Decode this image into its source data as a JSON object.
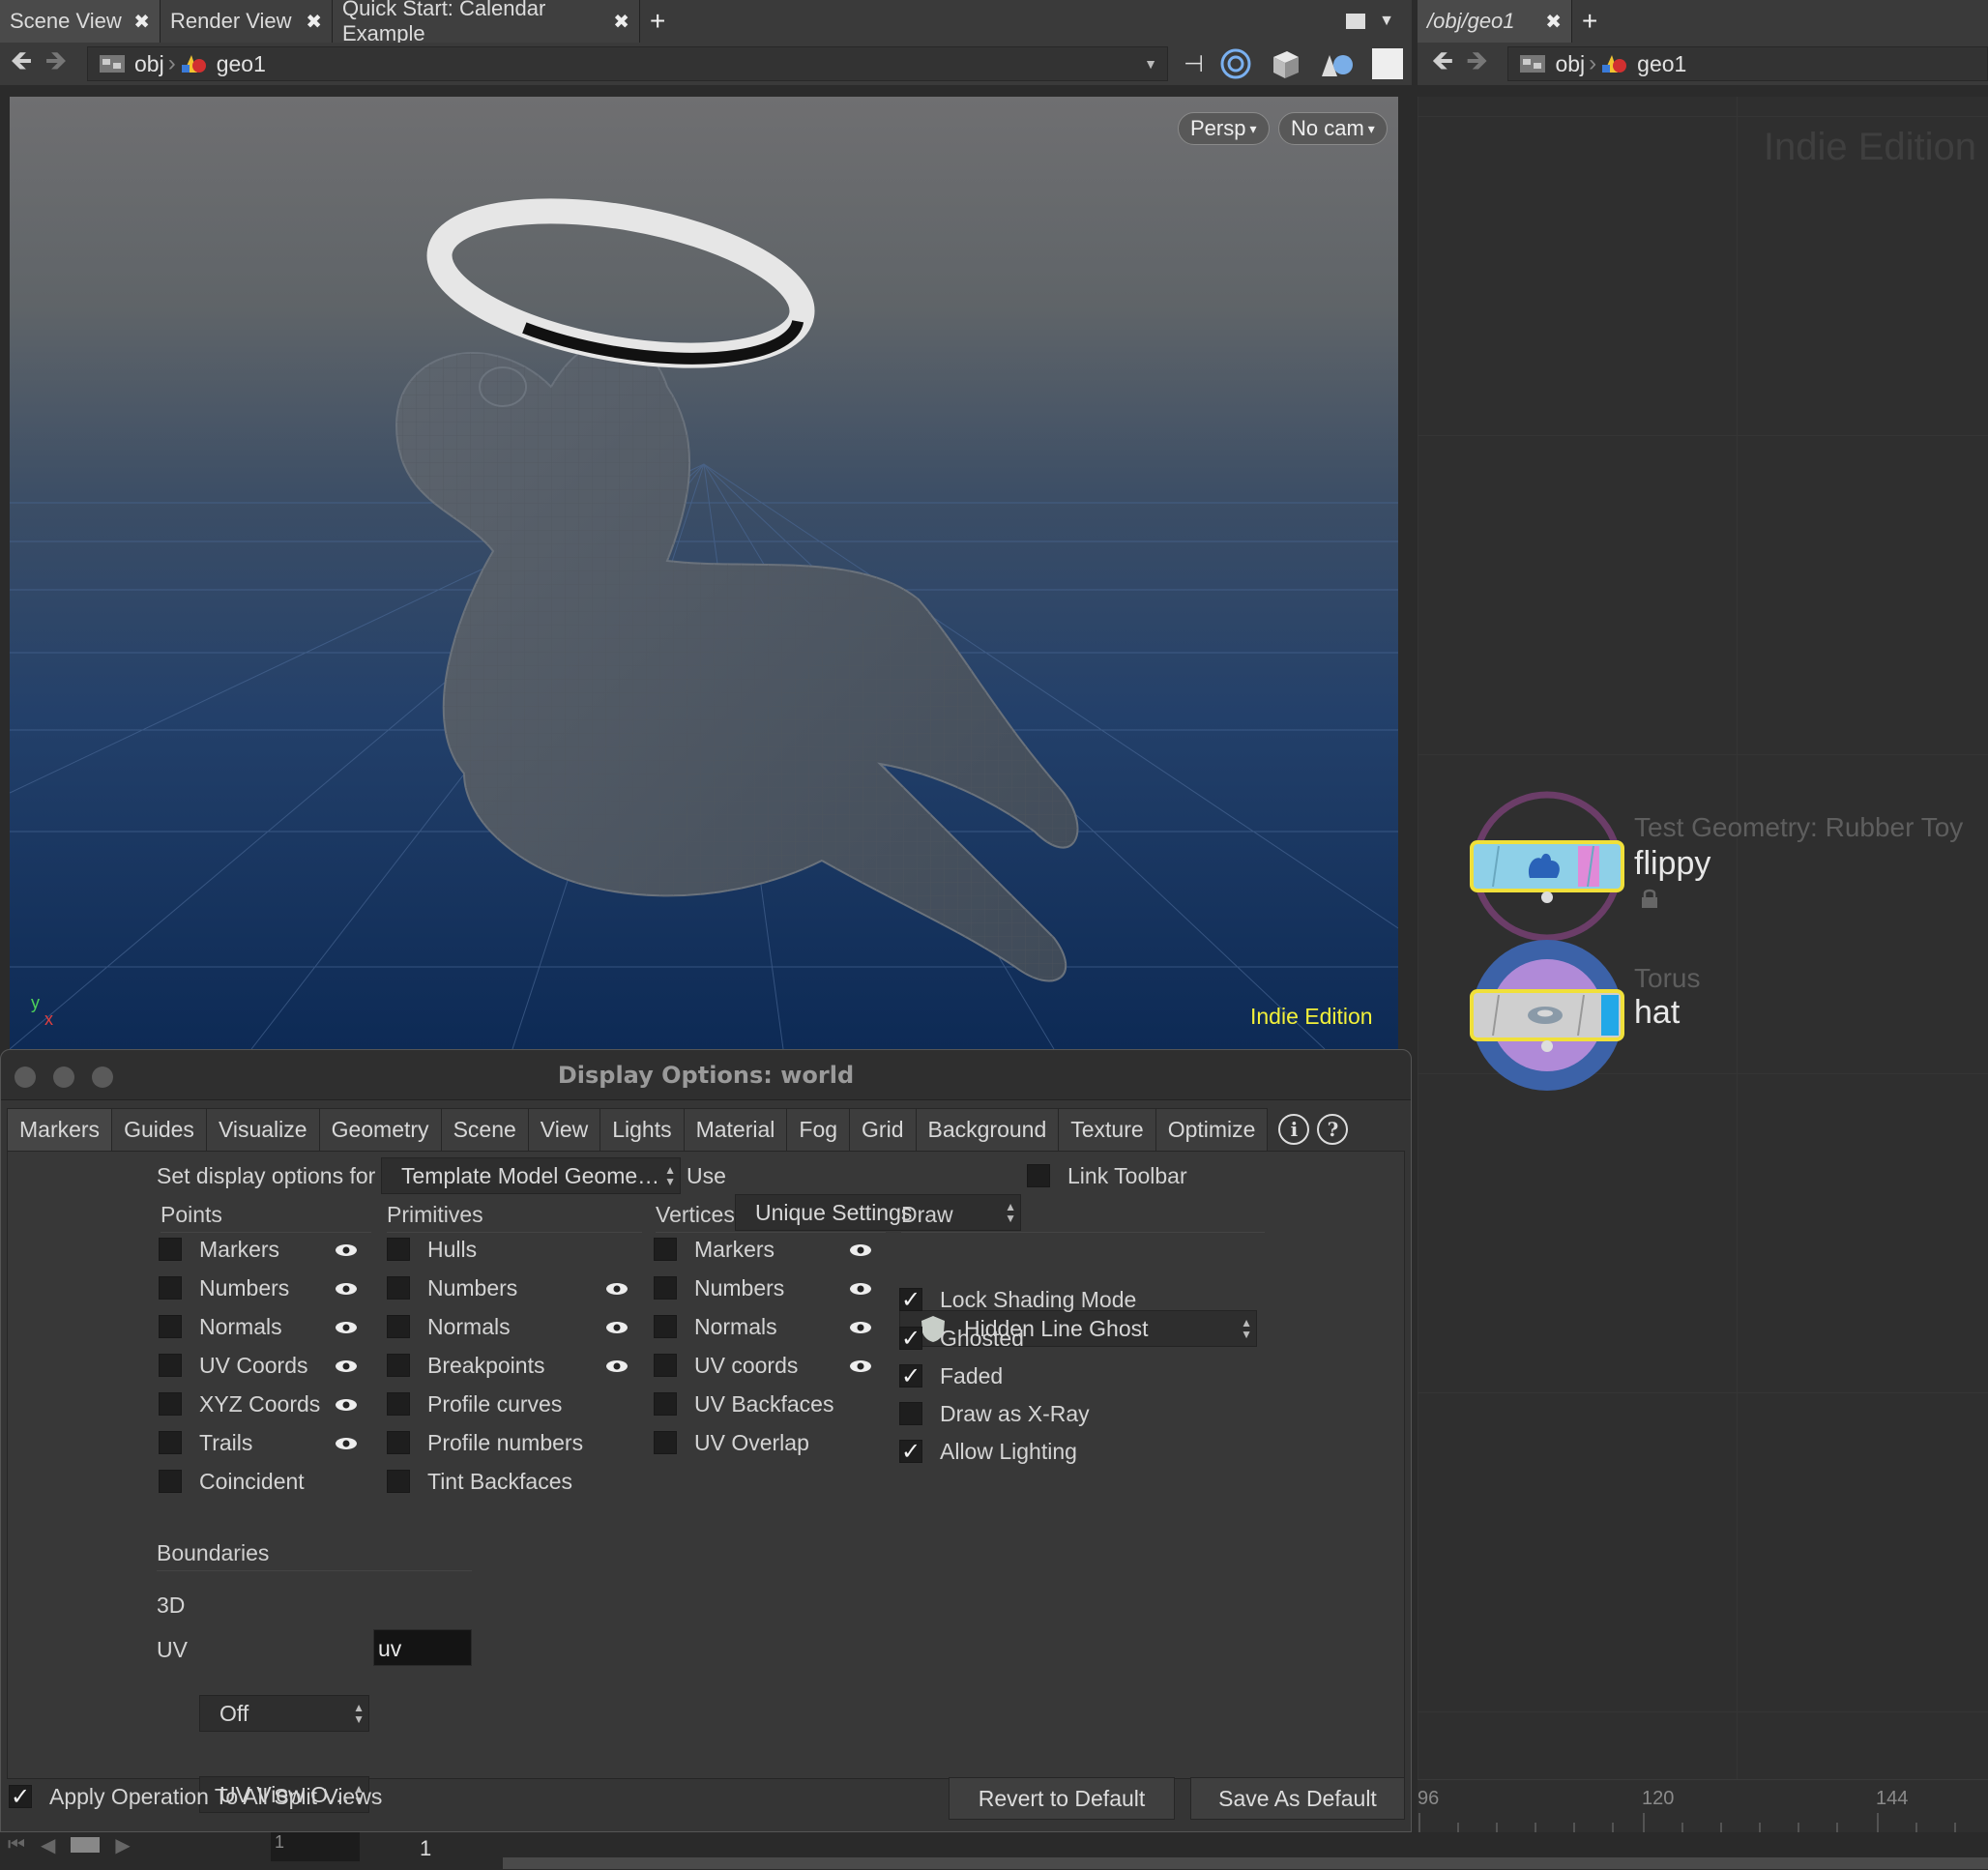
{
  "left_tabs": [
    {
      "label": "Scene View"
    },
    {
      "label": "Render View"
    },
    {
      "label": "Quick Start: Calendar Example"
    }
  ],
  "right_tabs": [
    {
      "label": "/obj/geo1"
    }
  ],
  "left_path": {
    "root": "obj",
    "node": "geo1"
  },
  "right_path": {
    "root": "obj",
    "node": "geo1"
  },
  "viewport": {
    "persp_label": "Persp",
    "cam_label": "No cam",
    "watermark": "Indie Edition",
    "axis_y": "y",
    "axis_x": "x"
  },
  "dialog": {
    "title": "Display Options:  world",
    "tabs": [
      "Markers",
      "Guides",
      "Visualize",
      "Geometry",
      "Scene",
      "View",
      "Lights",
      "Material",
      "Fog",
      "Grid",
      "Background",
      "Texture",
      "Optimize"
    ],
    "set_for_label": "Set display options for",
    "set_for_value": "Template Model Geome…",
    "use_label": "Use",
    "use_value": "Unique Settings",
    "link_toolbar": "Link Toolbar",
    "points": {
      "heading": "Points",
      "items": [
        "Markers",
        "Numbers",
        "Normals",
        "UV Coords",
        "XYZ Coords",
        "Trails",
        "Coincident"
      ]
    },
    "primitives": {
      "heading": "Primitives",
      "items": [
        "Hulls",
        "Numbers",
        "Normals",
        "Breakpoints",
        "Profile curves",
        "Profile numbers",
        "Tint Backfaces"
      ]
    },
    "vertices": {
      "heading": "Vertices",
      "items": [
        "Markers",
        "Numbers",
        "Normals",
        "UV coords",
        "UV Backfaces",
        "UV Overlap"
      ]
    },
    "draw": {
      "heading": "Draw",
      "mode": "Hidden Line Ghost",
      "items": [
        "Lock Shading Mode",
        "Ghosted",
        "Faded",
        "Draw as X-Ray",
        "Allow Lighting"
      ]
    },
    "boundaries": {
      "heading": "Boundaries",
      "label_3d": "3D",
      "value_3d": "Off",
      "label_uv": "UV",
      "value_uv": "UV View O…",
      "uv_input": "uv"
    },
    "apply_all": "Apply Operation To All Split Views",
    "revert_button": "Revert to Default",
    "save_button": "Save As Default"
  },
  "network": {
    "watermark": "Indie Edition",
    "nodes": [
      {
        "type": "Test Geometry: Rubber Toy",
        "name": "flippy"
      },
      {
        "type": "Torus",
        "name": "hat"
      }
    ]
  },
  "timeline": {
    "ticks": [
      "96",
      "120",
      "144"
    ],
    "frame": "1",
    "frame_small": "1"
  }
}
